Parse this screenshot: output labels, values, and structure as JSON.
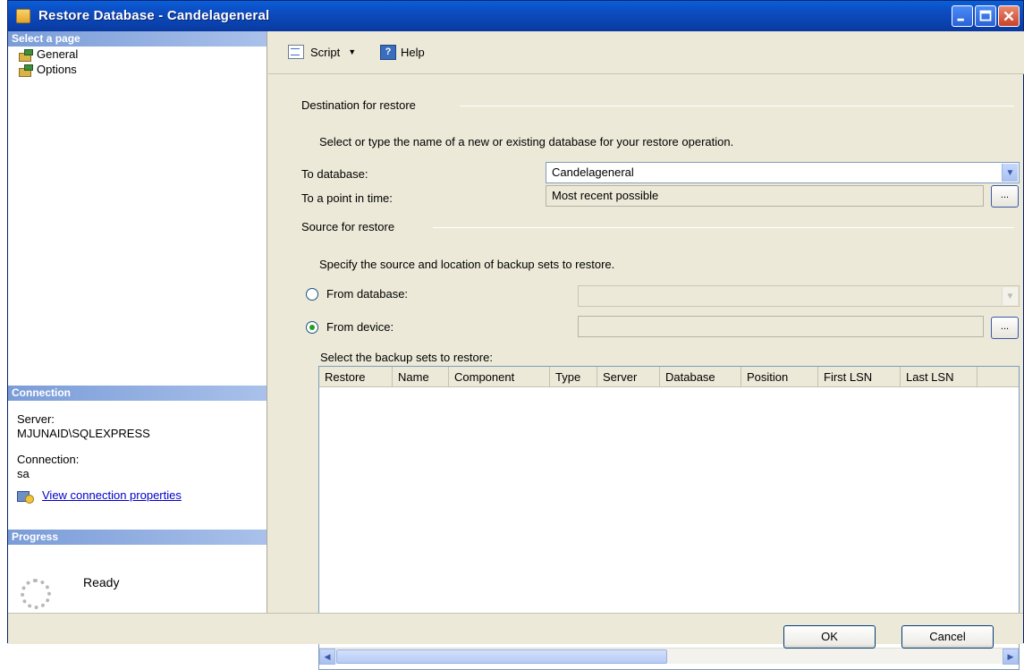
{
  "window": {
    "title": "Restore Database - Candelageneral",
    "buttons": [
      "minimize",
      "maximize",
      "close"
    ]
  },
  "left_pane": {
    "select_page_header": "Select a page",
    "pages": [
      {
        "label": "General",
        "icon": "page-icon"
      },
      {
        "label": "Options",
        "icon": "page-icon"
      }
    ],
    "connection_header": "Connection",
    "server_label": "Server:",
    "server_value": "MJUNAID\\SQLEXPRESS",
    "connection_label": "Connection:",
    "connection_value": "sa",
    "view_connection_link": "View connection properties",
    "progress_header": "Progress",
    "progress_status": "Ready"
  },
  "toolbar": {
    "script_label": "Script",
    "help_label": "Help"
  },
  "destination": {
    "title": "Destination for restore",
    "instruction": "Select or type the name of a new or existing database for your restore operation.",
    "to_database_label": "To database:",
    "to_database_value": "Candelageneral",
    "point_in_time_label": "To a point in time:",
    "point_in_time_value": "Most recent possible",
    "ellipsis": "..."
  },
  "source": {
    "title": "Source for restore",
    "instruction": "Specify the source and location of backup sets to restore.",
    "from_database_label": "From database:",
    "from_device_label": "From device:",
    "selected_option": "From device",
    "ellipsis": "..."
  },
  "backup_sets": {
    "label": "Select the backup sets to restore:",
    "columns": [
      "Restore",
      "Name",
      "Component",
      "Type",
      "Server",
      "Database",
      "Position",
      "First LSN",
      "Last LSN"
    ],
    "rows": []
  },
  "footer": {
    "ok_label": "OK",
    "cancel_label": "Cancel"
  },
  "colors": {
    "titlebar": "#0a4ec4",
    "pane_header": "#7a9cd8",
    "dialog_bg": "#ece9d8",
    "link": "#0000cc"
  }
}
